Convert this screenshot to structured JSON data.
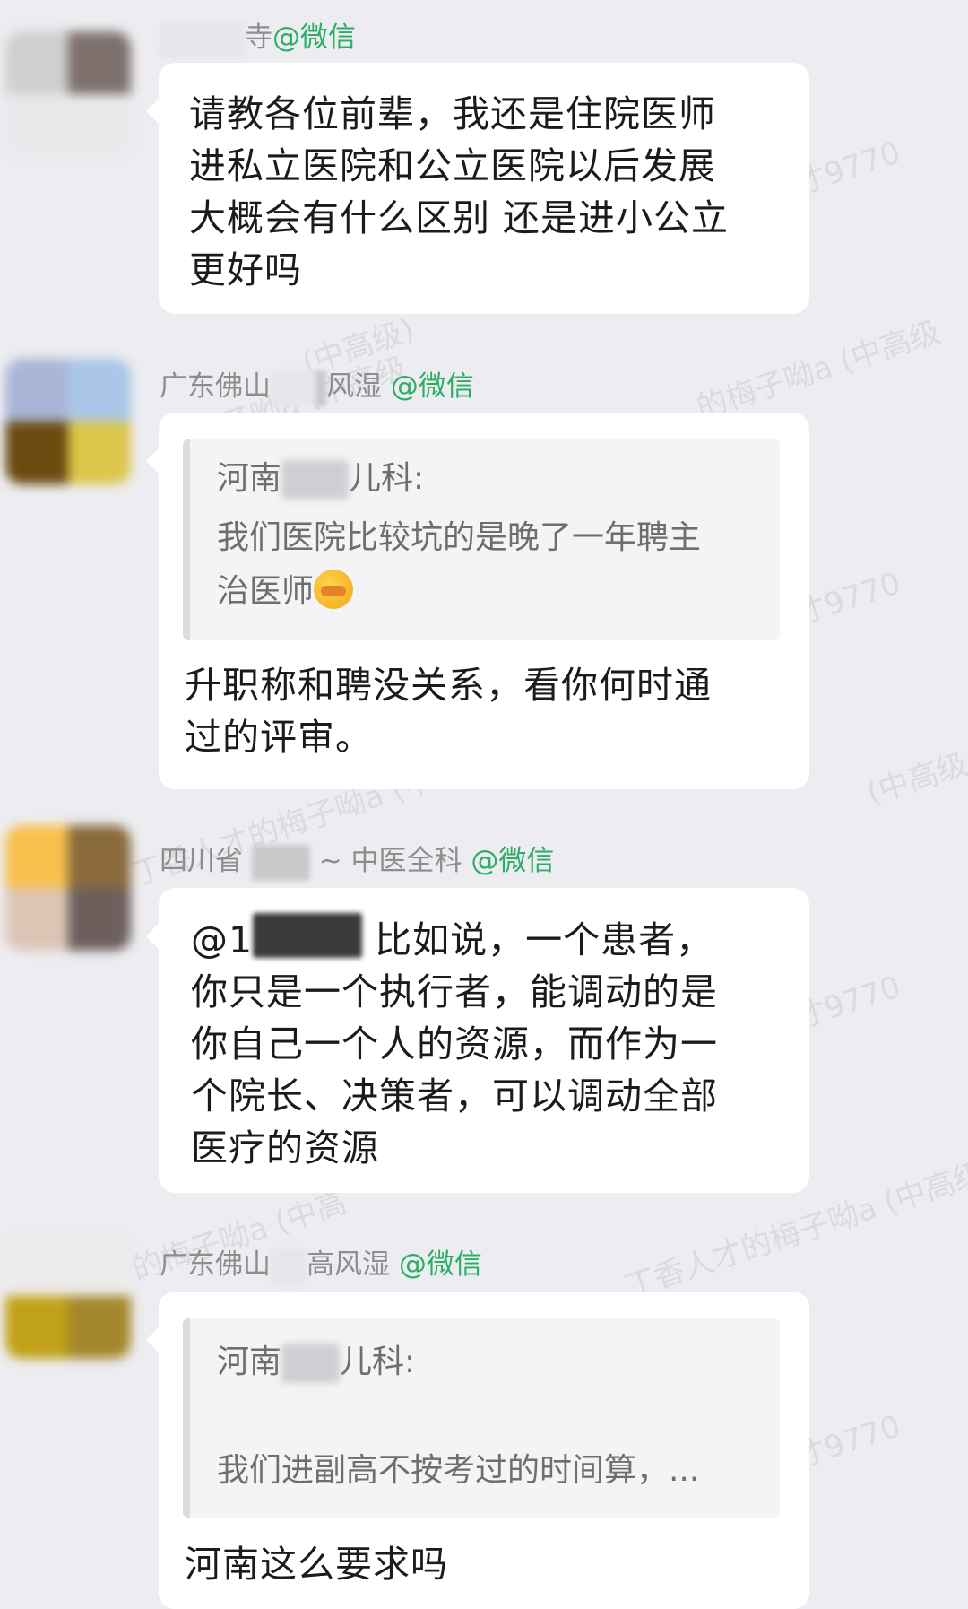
{
  "messages": [
    {
      "sender_visible": "寺",
      "wechat_tag": "@微信",
      "lines": [
        "请教各位前辈，我还是住院医师",
        "进私立医院和公立医院以后发展",
        "大概会有什么区别 还是进小公立",
        "更好吗"
      ]
    },
    {
      "sender_prefix": "广东佛山",
      "sender_suffix": "风湿",
      "wechat_tag": "@微信",
      "quote": {
        "name_prefix": "河南",
        "name_suffix": "儿科:",
        "lines": [
          "我们医院比较坑的是晚了一年聘主",
          "治医师"
        ],
        "emoji": "facepalm-emoji"
      },
      "lines": [
        "升职称和聘没关系，看你何时通",
        "过的评审。"
      ]
    },
    {
      "sender_prefix": "四川省",
      "sender_suffix": "~ 中医全科",
      "wechat_tag": "@微信",
      "mention_prefix": "@1",
      "first_line_rest": "比如说，一个患者，",
      "lines": [
        "你只是一个执行者，能调动的是",
        "你自己一个人的资源，而作为一",
        "个院长、决策者，可以调动全部",
        "医疗的资源"
      ]
    },
    {
      "sender_prefix": "广东佛山",
      "sender_suffix": "高风湿",
      "wechat_tag": "@微信",
      "quote": {
        "name_prefix": "河南",
        "name_suffix": "儿科:",
        "lines": [
          "我们进副高不按考过的时间算，..."
        ]
      },
      "lines": [
        "河南这么要求吗"
      ]
    }
  ],
  "watermark": {
    "texts": [
      "才9770",
      "(中高级)",
      "的梅子呦a (中高级",
      "的梅子呦a (中高级",
      "丁香人才的梅子呦a (中高级",
      "才9770",
      "(中高级",
      "丁香人才的梅子呦a (中高级",
      "才9770",
      "的梅子呦a (中高",
      "丁香人才的梅子呦a (中高级",
      "才9770"
    ]
  },
  "colors": {
    "background": "#ededf1",
    "bubble": "#ffffff",
    "wechat_green": "#2aae67",
    "sender_gray": "#8d8d8d",
    "quote_bg": "#f4f4f6"
  }
}
